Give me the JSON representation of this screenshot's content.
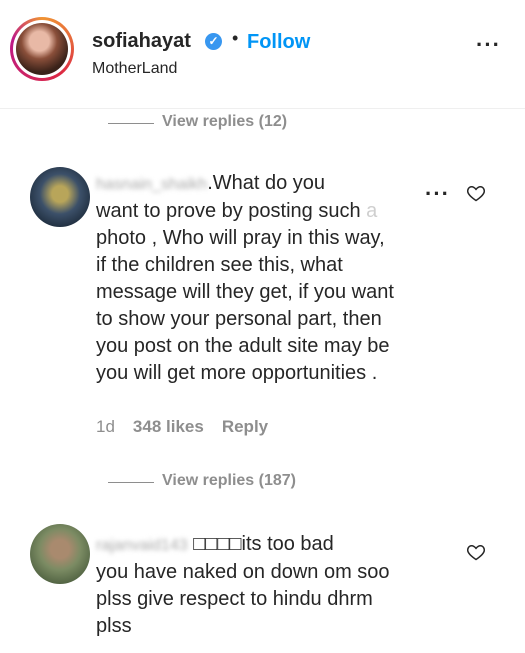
{
  "post_header": {
    "username": "sofiahayat",
    "follow_label": "Follow",
    "separator": "•",
    "location": "MotherLand",
    "more_icon": "more-horizontal-icon",
    "verified_icon": "verified-badge-icon"
  },
  "view_replies_top": {
    "label": "View replies (12)"
  },
  "comment_1": {
    "username": "hasnain_shaikh",
    "text_lines": [
      ".What do you",
      "want to prove by posting such",
      "photo , Who will pray in this way,",
      "if the children see this, what",
      "message will they get, if you want",
      "to show your personal part, then",
      "you post on the adult site may be",
      "you will get more opportunities ."
    ],
    "faded_char": "a",
    "time": "1d",
    "likes": "348 likes",
    "reply_label": "Reply"
  },
  "view_replies_mid": {
    "label": "View replies (187)"
  },
  "comment_2": {
    "username": "rajanvaid143",
    "text_lines": [
      "□□□□its too bad",
      "you have naked on down om soo",
      "plss give respect to hindu dhrm",
      "plss"
    ]
  },
  "colors": {
    "accent": "#0095f6",
    "muted": "#8e8e8e",
    "text": "#262626",
    "verified": "#3897f0"
  }
}
